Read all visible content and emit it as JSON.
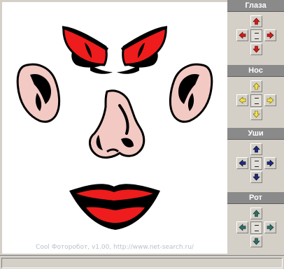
{
  "watermark": "Cool Фоторобот, v1.00, http://www.net-search.ru/",
  "panel": {
    "groups": [
      {
        "label": "Глаза",
        "arrow_color": "#cc1c1c"
      },
      {
        "label": "Нос",
        "arrow_color": "#e6d21a"
      },
      {
        "label": "Уши",
        "arrow_color": "#1c2a8a"
      },
      {
        "label": "Рот",
        "arrow_color": "#2e6e6a"
      }
    ]
  },
  "colors": {
    "eye_red": "#ee1c1c",
    "skin": "#f3c9c4",
    "lip_red": "#ee1c1c",
    "outline": "#000000"
  }
}
